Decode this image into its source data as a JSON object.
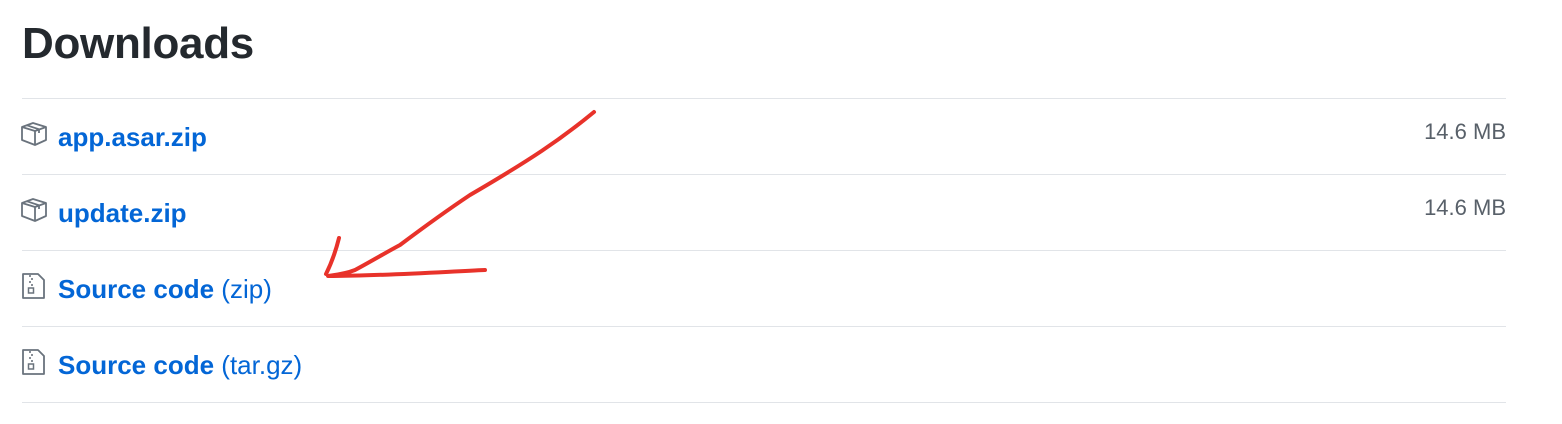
{
  "title": "Downloads",
  "assets": [
    {
      "icon": "package-icon",
      "name": "app.asar.zip",
      "ext": "",
      "size": "14.6 MB"
    },
    {
      "icon": "package-icon",
      "name": "update.zip",
      "ext": "",
      "size": "14.6 MB"
    },
    {
      "icon": "file-zip-icon",
      "name": "Source code",
      "ext": "(zip)",
      "size": ""
    },
    {
      "icon": "file-zip-icon",
      "name": "Source code",
      "ext": "(tar.gz)",
      "size": ""
    }
  ],
  "colors": {
    "link": "#0366d6",
    "heading": "#24292e",
    "muted": "#586069",
    "divider": "#e1e4e8",
    "annotation": "#e8322a"
  }
}
